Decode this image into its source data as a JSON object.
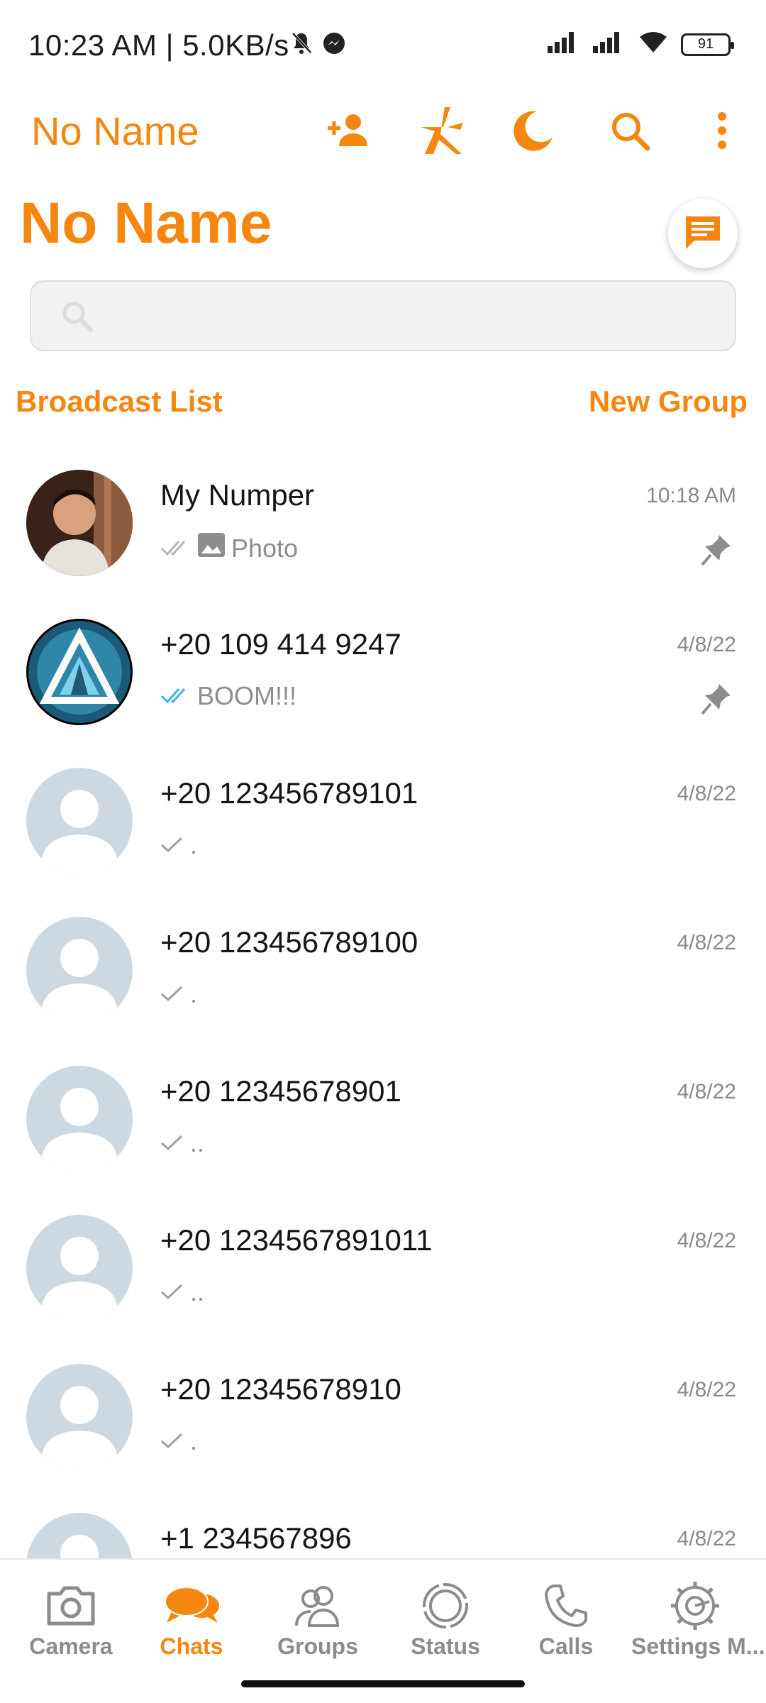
{
  "status_bar": {
    "time": "10:23 AM | 5.0KB/s",
    "battery": "91"
  },
  "app_bar": {
    "title": "No Name",
    "icons": [
      "add-contact-icon",
      "logo-icon",
      "moon-icon",
      "search-icon",
      "more-vert-icon"
    ]
  },
  "header": {
    "title": "No Name",
    "fab_icon": "message-icon"
  },
  "search": {
    "placeholder": "",
    "value": ""
  },
  "links": {
    "broadcast": "Broadcast List",
    "new_group": "New Group"
  },
  "chats": [
    {
      "name": "My Numper",
      "time": "10:18 AM",
      "tick": "double-grey",
      "media": "Photo",
      "preview": "Photo",
      "pinned": true,
      "avatar": "photo-person"
    },
    {
      "name": "+20 109 414 9247",
      "time": "4/8/22",
      "tick": "double-blue",
      "preview": "BOOM!!!",
      "pinned": true,
      "avatar": "photo-logo"
    },
    {
      "name": "+20 123456789101",
      "time": "4/8/22",
      "tick": "single",
      "preview": ".",
      "pinned": false,
      "avatar": "default"
    },
    {
      "name": "+20 123456789100",
      "time": "4/8/22",
      "tick": "single",
      "preview": ".",
      "pinned": false,
      "avatar": "default"
    },
    {
      "name": "+20 12345678901",
      "time": "4/8/22",
      "tick": "single",
      "preview": "..",
      "pinned": false,
      "avatar": "default"
    },
    {
      "name": "+20 1234567891011",
      "time": "4/8/22",
      "tick": "single",
      "preview": "..",
      "pinned": false,
      "avatar": "default"
    },
    {
      "name": "+20 12345678910",
      "time": "4/8/22",
      "tick": "single",
      "preview": ".",
      "pinned": false,
      "avatar": "default"
    },
    {
      "name": "+1 234567896",
      "time": "4/8/22",
      "tick": "single",
      "preview": "",
      "pinned": false,
      "avatar": "default"
    }
  ],
  "bottom_nav": {
    "tabs": [
      {
        "label": "Camera",
        "icon": "camera-icon",
        "active": false
      },
      {
        "label": "Chats",
        "icon": "chats-icon",
        "active": true
      },
      {
        "label": "Groups",
        "icon": "groups-icon",
        "active": false
      },
      {
        "label": "Status",
        "icon": "status-icon",
        "active": false
      },
      {
        "label": "Calls",
        "icon": "phone-icon",
        "active": false
      },
      {
        "label": "Settings M...",
        "icon": "settings-icon",
        "active": false
      }
    ]
  },
  "colors": {
    "accent": "#f5860f",
    "tick_blue": "#34b7f1",
    "muted": "#8d8d8d",
    "avatar_bg": "#ced8e0"
  }
}
